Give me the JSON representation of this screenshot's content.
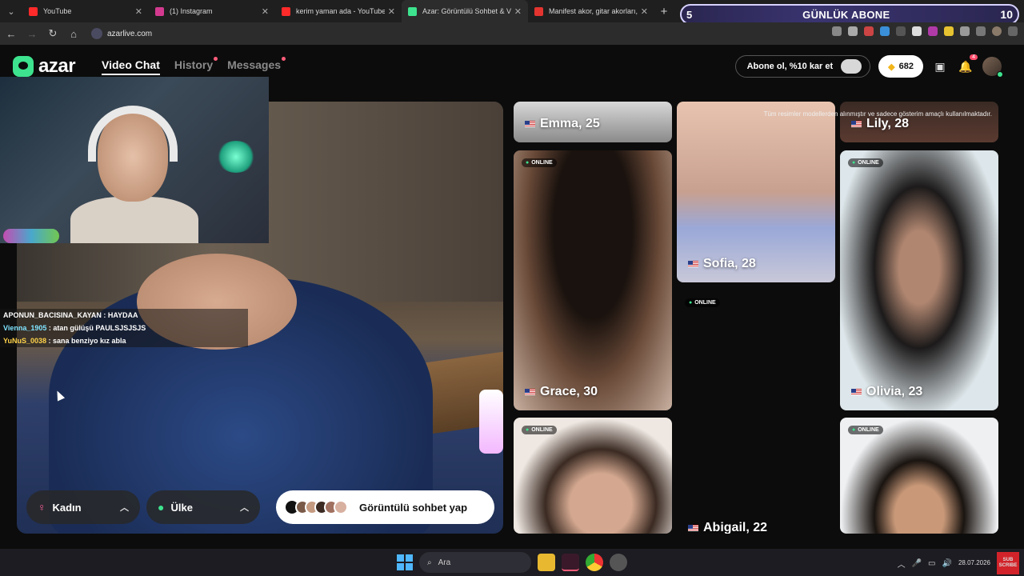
{
  "browser": {
    "tabs": [
      {
        "title": "YouTube",
        "color": "#ff2a2a"
      },
      {
        "title": "(1) Instagram",
        "color": "#d33a8f"
      },
      {
        "title": "kerim yaman ada - YouTube",
        "color": "#ff2a2a"
      },
      {
        "title": "Azar: Görüntülü Sohbet & V",
        "color": "#3de38e"
      },
      {
        "title": "Manifest akor, gitar akorları, şa",
        "color": "#e3342f"
      }
    ],
    "new_tab": "+",
    "url": "azarlive.com"
  },
  "overlay": {
    "left": "5",
    "label": "GÜNLÜK ABONE",
    "right": "10"
  },
  "app": {
    "logo": "azar",
    "nav": [
      {
        "label": "Video Chat",
        "active": true
      },
      {
        "label": "History",
        "dot": true
      },
      {
        "label": "Messages",
        "dot": true
      }
    ],
    "promo": "Abone ol, %10 kar et",
    "gems": "682",
    "notif_count": "4"
  },
  "chat": [
    {
      "user": "APONUN_BACISINA_KAYAN",
      "msg": "HAYDAA"
    },
    {
      "user": "Vienna_1905",
      "msg": "atan gülüşü PAULSJSJSJS"
    },
    {
      "user": "YuNuS_0038",
      "msg": "sana benziyo kız abla"
    }
  ],
  "controls": {
    "gender_label": "Kadın",
    "gender_icon": "female-icon",
    "country_label": "Ülke",
    "country_icon": "globe-icon",
    "cta_label": "Görüntülü sohbet yap"
  },
  "gallery": {
    "disclaimer": "Tüm resimler modellerden alınmıştır ve sadece gösterim amaçlı kullanılmaktadır.",
    "online_label": "ONLINE",
    "cards": [
      {
        "name": "Emma, 25"
      },
      {
        "name": "Sofia, 28"
      },
      {
        "name": "Lily, 28"
      },
      {
        "name": "Grace, 30"
      },
      {
        "name": "Olivia, 23"
      },
      {
        "name": "Abigail, 22"
      }
    ]
  },
  "taskbar": {
    "search": "Ara",
    "date": "28.07.2026",
    "subscribe": "SUB SCRIBE"
  }
}
